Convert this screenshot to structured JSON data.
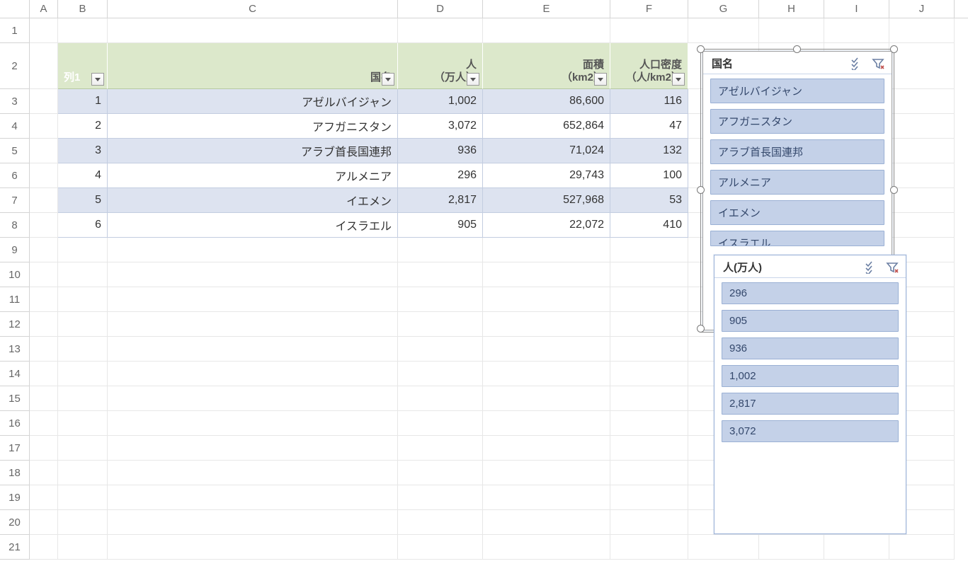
{
  "columns": [
    "A",
    "B",
    "C",
    "D",
    "E",
    "F",
    "G",
    "H",
    "I",
    "J"
  ],
  "row_count": 21,
  "table": {
    "headers": {
      "col1": "列1",
      "country": "国名",
      "population": "人（万人）",
      "area": "面積（km2）",
      "density": "人口密度（人/km2）",
      "population_line1": "人",
      "population_line2": "（万人）",
      "area_line1": "面積",
      "area_line2": "（km2）",
      "density_line1": "人口密度",
      "density_line2": "（人/km2）"
    },
    "rows": [
      {
        "n": "1",
        "country": "アゼルバイジャン",
        "pop": "1,002",
        "area": "86,600",
        "dens": "116"
      },
      {
        "n": "2",
        "country": "アフガニスタン",
        "pop": "3,072",
        "area": "652,864",
        "dens": "47"
      },
      {
        "n": "3",
        "country": "アラブ首長国連邦",
        "pop": "936",
        "area": "71,024",
        "dens": "132"
      },
      {
        "n": "4",
        "country": "アルメニア",
        "pop": "296",
        "area": "29,743",
        "dens": "100"
      },
      {
        "n": "5",
        "country": "イエメン",
        "pop": "2,817",
        "area": "527,968",
        "dens": "53"
      },
      {
        "n": "6",
        "country": "イスラエル",
        "pop": "905",
        "area": "22,072",
        "dens": "410"
      }
    ]
  },
  "slicers": {
    "country": {
      "title": "国名",
      "items": [
        "アゼルバイジャン",
        "アフガニスタン",
        "アラブ首長国連邦",
        "アルメニア",
        "イエメン",
        "イスラエル"
      ]
    },
    "population": {
      "title": "人(万人)",
      "items": [
        "296",
        "905",
        "936",
        "1,002",
        "2,817",
        "3,072"
      ]
    }
  }
}
